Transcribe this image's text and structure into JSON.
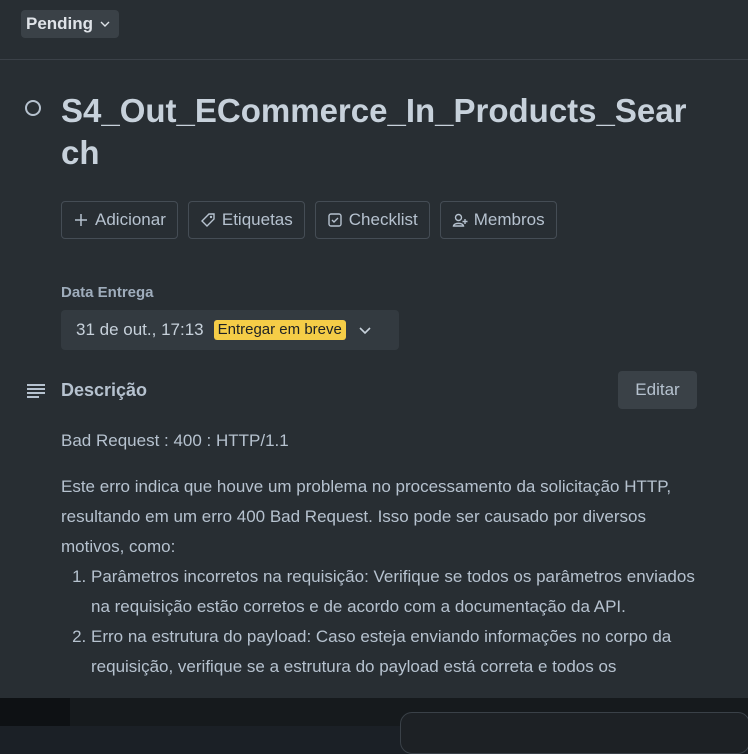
{
  "status": {
    "label": "Pending"
  },
  "card": {
    "title": "S4_Out_ECommerce_In_Products_Search"
  },
  "actions": [
    {
      "label": "Adicionar",
      "icon": "plus-icon"
    },
    {
      "label": "Etiquetas",
      "icon": "tag-icon"
    },
    {
      "label": "Checklist",
      "icon": "checklist-icon"
    },
    {
      "label": "Membros",
      "icon": "add-member-icon"
    }
  ],
  "due": {
    "label": "Data Entrega",
    "date": "31 de out., 17:13",
    "badge": "Entregar em breve",
    "badge_color": "#f5cd47"
  },
  "description": {
    "heading": "Descrição",
    "edit_label": "Editar",
    "line1": "Bad Request : 400 : HTTP/1.1",
    "paragraph": "Este erro indica que houve um problema no processamento da solicitação HTTP, resultando em um erro 400 Bad Request. Isso pode ser causado por diversos motivos, como:",
    "items": [
      "Parâmetros incorretos na requisição: Verifique se todos os parâmetros enviados na requisição estão corretos e de acordo com a documentação da API.",
      "Erro na estrutura do payload: Caso esteja enviando informações no corpo da requisição, verifique se a estrutura do payload está correta e todos os"
    ]
  }
}
